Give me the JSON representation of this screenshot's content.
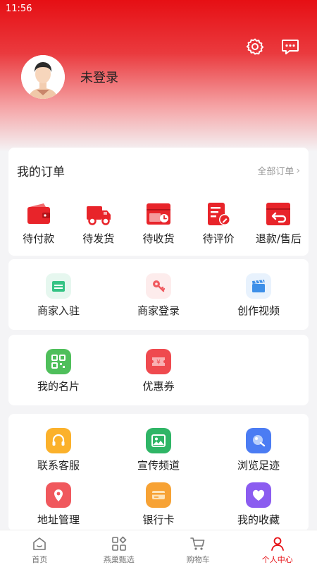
{
  "status": {
    "time": "11:56"
  },
  "profile": {
    "login_text": "未登录"
  },
  "orders": {
    "title": "我的订单",
    "all_label": "全部订单",
    "items": [
      {
        "label": "待付款",
        "icon": "wallet-icon"
      },
      {
        "label": "待发货",
        "icon": "truck-icon"
      },
      {
        "label": "待收货",
        "icon": "receive-icon"
      },
      {
        "label": "待评价",
        "icon": "review-icon"
      },
      {
        "label": "退款/售后",
        "icon": "refund-icon"
      }
    ]
  },
  "merchant": {
    "items": [
      {
        "label": "商家入驻",
        "icon": "shop-icon"
      },
      {
        "label": "商家登录",
        "icon": "key-icon"
      },
      {
        "label": "创作视频",
        "icon": "clapper-icon"
      }
    ]
  },
  "cards": {
    "items": [
      {
        "label": "我的名片",
        "icon": "qrcode-icon"
      },
      {
        "label": "优惠券",
        "icon": "coupon-icon"
      }
    ]
  },
  "services": {
    "items": [
      {
        "label": "联系客服",
        "icon": "headset-icon"
      },
      {
        "label": "宣传频道",
        "icon": "image-icon"
      },
      {
        "label": "浏览足迹",
        "icon": "footprint-icon"
      },
      {
        "label": "地址管理",
        "icon": "location-icon"
      },
      {
        "label": "银行卡",
        "icon": "bankcard-icon"
      },
      {
        "label": "我的收藏",
        "icon": "heart-icon"
      }
    ]
  },
  "tabs": [
    {
      "label": "首页",
      "icon": "home-icon"
    },
    {
      "label": "燕巢甄选",
      "icon": "category-icon"
    },
    {
      "label": "购物车",
      "icon": "cart-icon"
    },
    {
      "label": "个人中心",
      "icon": "person-icon",
      "active": true
    }
  ],
  "colors": {
    "accent": "#e60f14",
    "muted": "#999999"
  }
}
